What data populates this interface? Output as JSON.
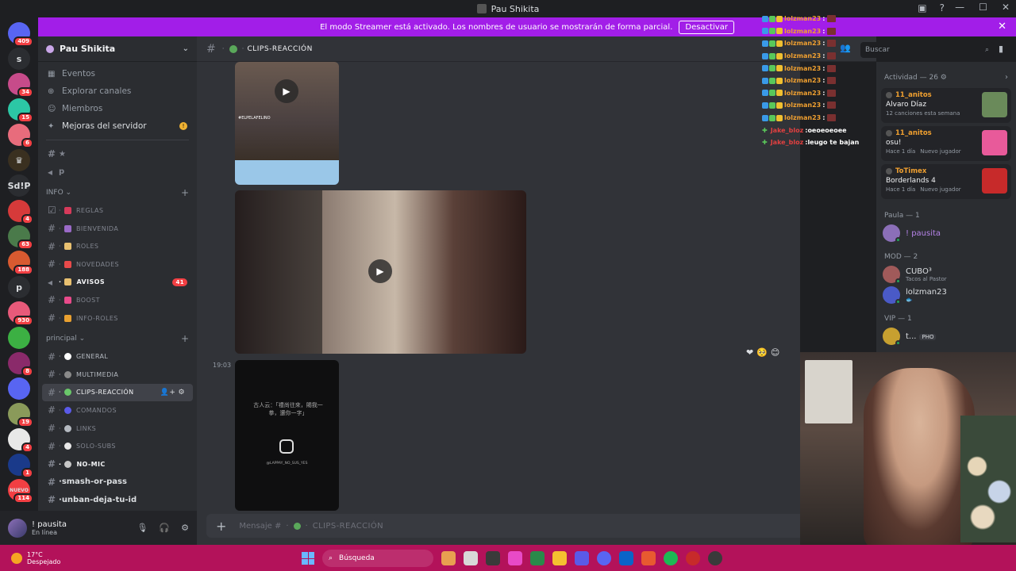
{
  "window": {
    "title": "Pau Shikita"
  },
  "banner": {
    "text": "El modo Streamer está activado. Los nombres de usuario se mostrarán de forma parcial.",
    "button": "Desactivar"
  },
  "guilds": [
    {
      "badge": "409",
      "color": "#5865f2",
      "text": ""
    },
    {
      "badge": "",
      "color": "#2b2d31",
      "text": "s"
    },
    {
      "badge": "34",
      "color": "#c74b8a",
      "text": ""
    },
    {
      "badge": "15",
      "color": "#2cc7a5",
      "text": ""
    },
    {
      "badge": "6",
      "color": "#e86c7c",
      "text": ""
    },
    {
      "badge": "",
      "color": "#3a3020",
      "text": "♛"
    },
    {
      "badge": "",
      "color": "#2b2d31",
      "text": "Sd!P"
    },
    {
      "badge": "4",
      "color": "#d63a3a",
      "text": ""
    },
    {
      "badge": "63",
      "color": "#4a7a4a",
      "text": ""
    },
    {
      "badge": "188",
      "color": "#d85a30",
      "text": ""
    },
    {
      "badge": "",
      "color": "#2b2d31",
      "text": "p"
    },
    {
      "badge": "930",
      "color": "#e85a7a",
      "text": ""
    },
    {
      "badge": "",
      "color": "#3cb043",
      "text": ""
    },
    {
      "badge": "8",
      "color": "#8a2a6a",
      "text": ""
    },
    {
      "badge": "",
      "color": "#5865f2",
      "text": ""
    },
    {
      "badge": "19",
      "color": "#8a9a5a",
      "text": ""
    },
    {
      "badge": "4",
      "color": "#e8e8e8",
      "text": ""
    },
    {
      "badge": "1",
      "color": "#1a3a8a",
      "text": ""
    },
    {
      "badge": "114",
      "color": "#f23f43",
      "text": "NUEVO"
    }
  ],
  "server": {
    "name": "Pau Shikita",
    "menu": [
      {
        "icon": "calendar-icon",
        "glyph": "▦",
        "label": "Eventos"
      },
      {
        "icon": "compass-icon",
        "glyph": "⊕",
        "label": "Explorar canales"
      },
      {
        "icon": "members-icon",
        "glyph": "☺",
        "label": "Miembros"
      },
      {
        "icon": "boost-icon",
        "glyph": "✦",
        "label": "Mejoras del servidor"
      }
    ],
    "top_channels": [
      {
        "icon": "#",
        "name": "★"
      },
      {
        "icon": "🔊",
        "name": "p"
      }
    ],
    "cat_info": "INFO",
    "info_channels": [
      {
        "icon": "☑",
        "color": "#d63a5a",
        "name": "REGLAS",
        "bright": false
      },
      {
        "icon": "#",
        "color": "#9a6ac7",
        "name": "BIENVENIDA",
        "bright": false
      },
      {
        "icon": "#",
        "color": "#e8c070",
        "name": "ROLES",
        "bright": false
      },
      {
        "icon": "#",
        "color": "#e84a4a",
        "name": "NOVEDADES",
        "bright": false
      },
      {
        "icon": "📢",
        "color": "#e8c070",
        "name": "AVISOS",
        "bright": true,
        "count": "41"
      },
      {
        "icon": "#",
        "color": "#e84a8a",
        "name": "BOOST",
        "bright": false
      },
      {
        "icon": "#",
        "color": "#e8a030",
        "name": "INFO-ROLES",
        "bright": false
      }
    ],
    "cat_main": "principal",
    "main_channels": [
      {
        "name": "GENERAL",
        "color": "#ffffff"
      },
      {
        "name": "MULTIMEDIA",
        "color": "#8a8a8a"
      },
      {
        "name": "CLIPS-REACCIÓN",
        "color": "#6ac76a",
        "active": true
      },
      {
        "name": "COMANDOS",
        "color": "#5a5ae8"
      },
      {
        "name": "LINKS",
        "color": "#b5bac1"
      },
      {
        "name": "SOLO-SUBS",
        "color": "#e8e8e8"
      },
      {
        "name": "NO-MIC",
        "color": "#c7c7c7",
        "bright": true
      }
    ],
    "extra_channels": [
      "smash-or-pass",
      "unban-deja-tu-id"
    ]
  },
  "user": {
    "name": "! pausita",
    "status": "En línea"
  },
  "chat": {
    "channel": "CLIPS-REACCIÓN",
    "timestamp": "19:03",
    "composer_placeholder": "Mensaje #",
    "composer_channel": "CLIPS-REACCIÓN",
    "media_caption_1": "#ELPELAFELINO",
    "media_caption_3": "古人云：「禮尚往來，賜我一拳，還你一字」",
    "media_handle_3": "@LAPPAY_NO_SUS_YES",
    "reactions": [
      "❤",
      "🥺",
      "😊"
    ]
  },
  "overlay_chat": [
    {
      "user": "lolzman23",
      "msg": "",
      "alt": false,
      "plus": false
    },
    {
      "user": "lolzman23",
      "msg": "",
      "alt": false,
      "plus": false
    },
    {
      "user": "lolzman23",
      "msg": "",
      "alt": false,
      "plus": false
    },
    {
      "user": "lolzman23",
      "msg": "",
      "alt": false,
      "plus": false
    },
    {
      "user": "lolzman23",
      "msg": "",
      "alt": false,
      "plus": false
    },
    {
      "user": "lolzman23",
      "msg": "",
      "alt": false,
      "plus": false
    },
    {
      "user": "lolzman23",
      "msg": "",
      "alt": false,
      "plus": false
    },
    {
      "user": "lolzman23",
      "msg": "",
      "alt": false,
      "plus": false
    },
    {
      "user": "lolzman23",
      "msg": "",
      "alt": false,
      "plus": false
    },
    {
      "user": "Jake_bloz",
      "msg": "oeoeoeoee",
      "alt": true,
      "plus": true
    },
    {
      "user": "Jake_bloz",
      "msg": "leugo te bajan",
      "alt": true,
      "plus": true
    }
  ],
  "search": {
    "placeholder": "Buscar"
  },
  "activity": {
    "title": "Actividad — 26",
    "cards": [
      {
        "user": "11_anitos",
        "title": "Alvaro Díaz",
        "sub": "12 canciones esta semana",
        "sub2": "",
        "thumb": "#6a8a5a"
      },
      {
        "user": "11_anitos",
        "title": "osu!",
        "sub": "Hace 1 día",
        "sub2": "Nuevo jugador",
        "thumb": "#e85a9a"
      },
      {
        "user": "ToTimex",
        "title": "Borderlands 4",
        "sub": "Hace 1 día",
        "sub2": "Nuevo jugador",
        "thumb": "#c72a2a"
      }
    ]
  },
  "member_groups": [
    {
      "title": "Paula — 1",
      "members": [
        {
          "name": "! pausita",
          "sub": "",
          "purple": true,
          "color": "#8b6fb8"
        }
      ]
    },
    {
      "title": "MOD — 2",
      "members": [
        {
          "name": "CUBO³",
          "sub": "Tacos al Pastor",
          "purple": false,
          "color": "#a05a5a"
        },
        {
          "name": "lolzman23",
          "sub": "🐟",
          "purple": false,
          "color": "#4a5ac7"
        }
      ]
    },
    {
      "title": "VIP — 1",
      "members": [
        {
          "name": "t...",
          "sub": "",
          "purple": false,
          "color": "#c7a030",
          "tag": "PHO"
        }
      ]
    }
  ],
  "taskbar": {
    "temp": "17°C",
    "weather": "Despejado",
    "search": "Búsqueda",
    "apps": [
      "#e8a050",
      "#d8d8d8",
      "#3a3a3a",
      "#e84ac7",
      "#2a8a4a",
      "#f5c030",
      "#5a5ae8",
      "#5865f2",
      "#0a64c8",
      "#e85a30",
      "#1db954",
      "#c72a2a",
      "#3a3a3a"
    ]
  }
}
